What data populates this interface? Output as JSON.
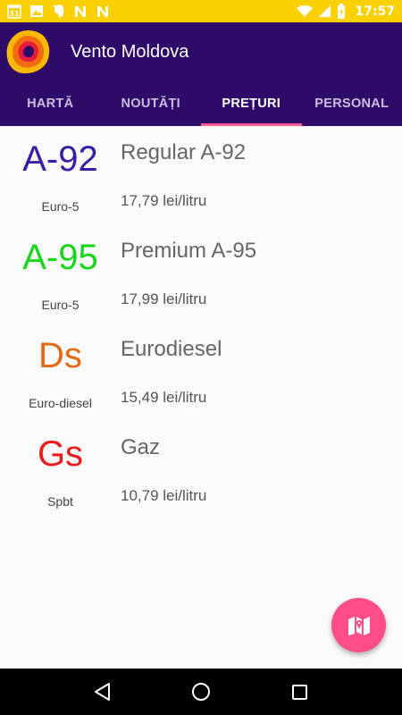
{
  "status_bar": {
    "time": "17:57",
    "calendar_day": "31",
    "left_icons": [
      "calendar-icon",
      "image-icon",
      "evernote-icon",
      "n-icon",
      "n-icon"
    ],
    "right_icons": [
      "wifi-icon",
      "signal-icon",
      "battery-charging-icon"
    ],
    "background": "#fbd000"
  },
  "app": {
    "title": "Vento Moldova",
    "bar_color": "#2e0b68",
    "accent": "#ff5a92"
  },
  "tabs": [
    {
      "label": "HARTĂ",
      "active": false
    },
    {
      "label": "NOUTĂȚI",
      "active": false
    },
    {
      "label": "PREȚURI",
      "active": true
    },
    {
      "label": "PERSONAL",
      "active": false
    }
  ],
  "fuels": [
    {
      "code": "A-92",
      "standard": "Euro-5",
      "name": "Regular A-92",
      "price": "17,79 lei/litru",
      "color": "#3b1ca6"
    },
    {
      "code": "A-95",
      "standard": "Euro-5",
      "name": "Premium A-95",
      "price": "17,99 lei/litru",
      "color": "#19d61b"
    },
    {
      "code": "Ds",
      "standard": "Euro-diesel",
      "name": "Eurodiesel",
      "price": "15,49 lei/litru",
      "color": "#e36a13"
    },
    {
      "code": "Gs",
      "standard": "Spbt",
      "name": "Gaz",
      "price": "10,79 lei/litru",
      "color": "#ec1b1b"
    }
  ],
  "fab": {
    "icon": "map-icon",
    "color": "#ff4d8a"
  },
  "nav_bar": {
    "icons": [
      "back-icon",
      "home-icon",
      "recents-icon"
    ]
  }
}
